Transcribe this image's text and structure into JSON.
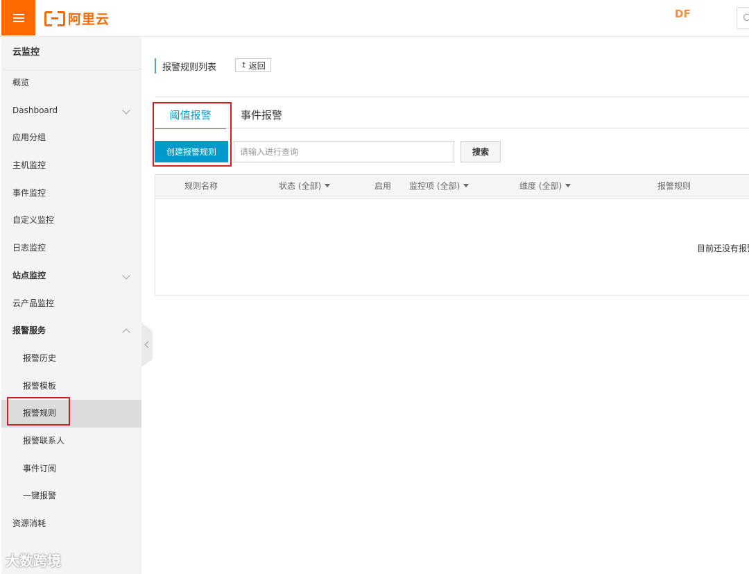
{
  "header": {
    "logo_text": "阿里云",
    "user": "DF"
  },
  "sidebar": {
    "title": "云监控",
    "items": [
      {
        "label": "概览"
      },
      {
        "label": "Dashboard"
      },
      {
        "label": "应用分组"
      },
      {
        "label": "主机监控"
      },
      {
        "label": "事件监控"
      },
      {
        "label": "自定义监控"
      },
      {
        "label": "日志监控"
      },
      {
        "label": "站点监控"
      },
      {
        "label": "云产品监控"
      },
      {
        "label": "报警服务"
      },
      {
        "label": "报警历史"
      },
      {
        "label": "报警模板"
      },
      {
        "label": "报警规则"
      },
      {
        "label": "报警联系人"
      },
      {
        "label": "事件订阅"
      },
      {
        "label": "一键报警"
      },
      {
        "label": "资源消耗"
      }
    ]
  },
  "main": {
    "title": "报警规则列表",
    "back_label": "返回",
    "back_icon": "↥",
    "tabs": [
      {
        "label": "阈值报警"
      },
      {
        "label": "事件报警"
      }
    ],
    "create_label": "创建报警规则",
    "search_placeholder": "请输入进行查询",
    "search_label": "搜索",
    "table": {
      "columns": [
        "规则名称",
        "状态 (全部)",
        "启用",
        "监控项 (全部)",
        "维度 (全部)",
        "报警规则"
      ],
      "empty_text": "目前还没有报警"
    }
  },
  "watermark": "大数跨境",
  "colors": {
    "brand": "#ff6a00",
    "accent": "#00a2ca",
    "primary_button": "#0099cc",
    "highlight": "#d9191f"
  }
}
